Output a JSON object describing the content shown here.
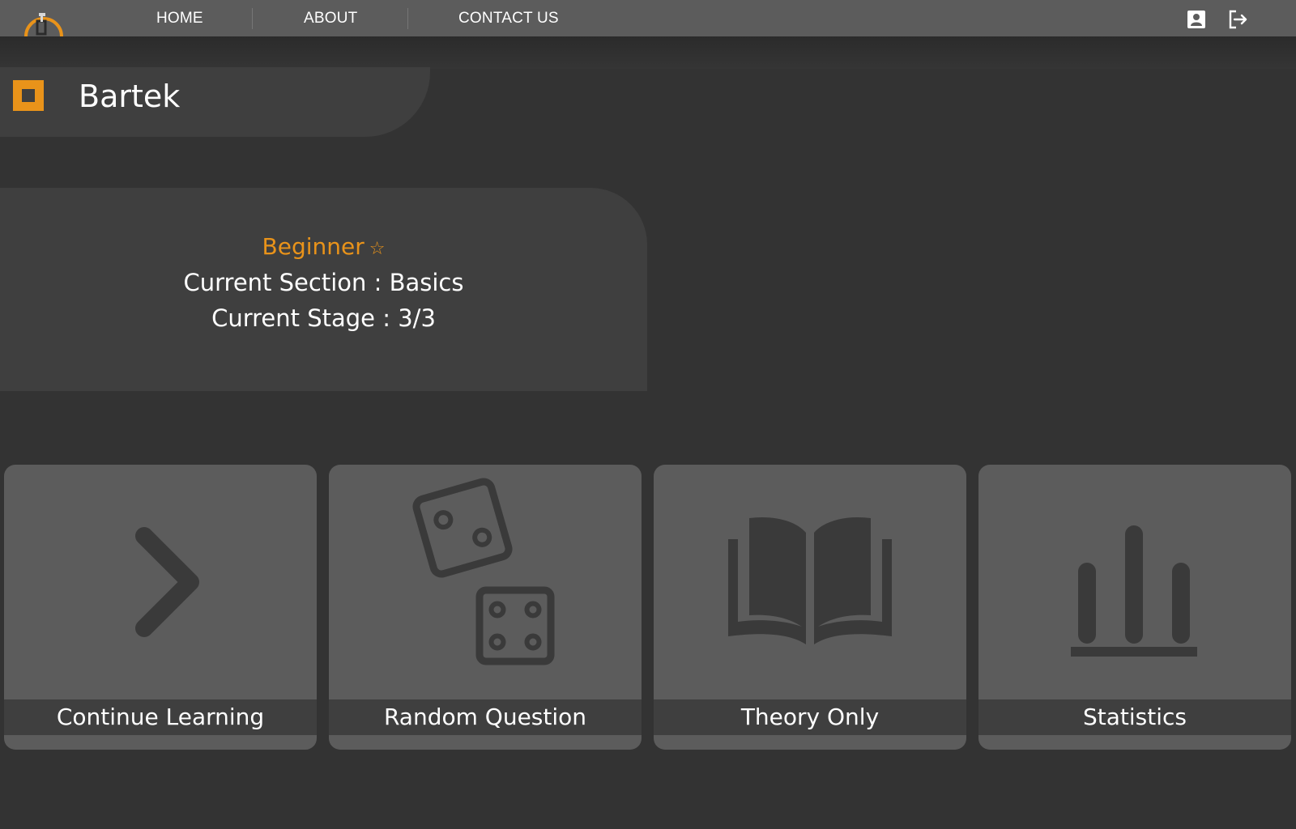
{
  "nav": {
    "items": [
      "HOME",
      "ABOUT",
      "CONTACT US"
    ],
    "icons": [
      "profile-icon",
      "logout-icon"
    ]
  },
  "user": {
    "name": "Bartek"
  },
  "progress": {
    "level": "Beginner",
    "level_icon": "star-icon",
    "section_line": "Current Section : Basics",
    "stage_line": "Current Stage : 3/3"
  },
  "tiles": [
    {
      "label": "Continue Learning",
      "icon": "chevron-right-icon"
    },
    {
      "label": "Random Question",
      "icon": "dice-icon"
    },
    {
      "label": "Theory Only",
      "icon": "book-icon"
    },
    {
      "label": "Statistics",
      "icon": "bar-chart-icon"
    }
  ],
  "colors": {
    "accent": "#e9931a",
    "background": "#333333",
    "topbar": "#5c5c5c",
    "panel": "#3f3f3f",
    "tile": "#5c5c5c",
    "tile_icon": "#3a3a3a"
  }
}
